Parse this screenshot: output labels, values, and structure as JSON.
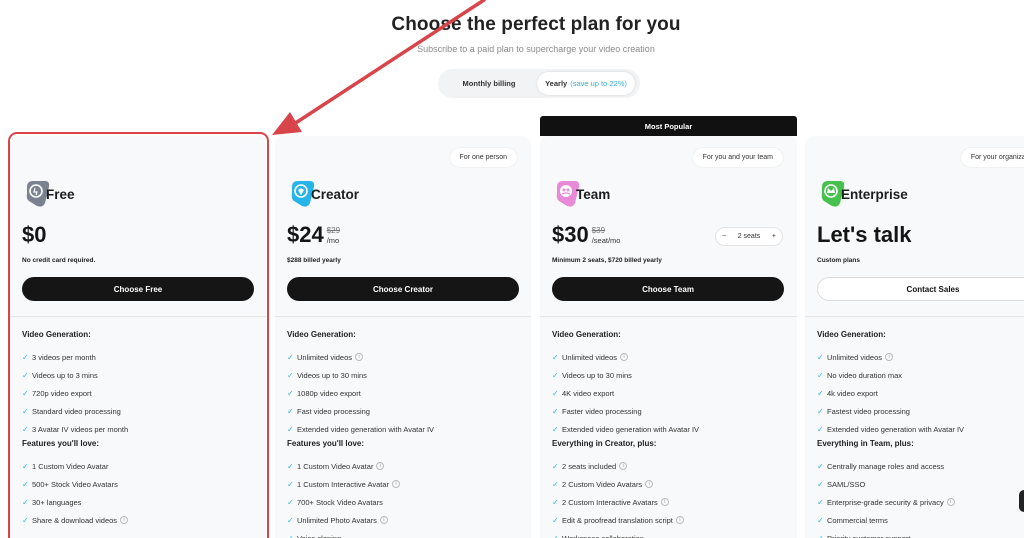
{
  "header": {
    "title": "Choose the perfect plan for you",
    "subtitle": "Subscribe to a paid plan to supercharge your video creation"
  },
  "billing_toggle": {
    "monthly_label": "Monthly billing",
    "yearly_label": "Yearly",
    "yearly_save": "(save up to 22%)",
    "selected": "Yearly"
  },
  "popular_label": "Most Popular",
  "colors": {
    "accent_check": "#2fb6dd",
    "highlight_outline": "#d9444a",
    "free_icon": "#7a8290",
    "creator_icon": "#28b4e8",
    "team_icon": "#e98ad8",
    "enterprise_icon": "#46c14d"
  },
  "plans": [
    {
      "name": "Free",
      "icon": "free-plan-icon",
      "audience": "",
      "price": "$0",
      "price_old": "",
      "price_unit": "",
      "note": "No credit card required.",
      "cta": "Choose Free",
      "sections": [
        {
          "title": "Video Generation:",
          "items": [
            {
              "text": "3 videos per month",
              "info": false
            },
            {
              "text": "Videos up to 3 mins",
              "info": false
            },
            {
              "text": "720p video export",
              "info": false
            },
            {
              "text": "Standard video processing",
              "info": false
            },
            {
              "text": "3 Avatar IV videos per month",
              "info": false
            }
          ]
        },
        {
          "title": "Features you'll love:",
          "items": [
            {
              "text": "1 Custom Video Avatar",
              "info": false
            },
            {
              "text": "500+ Stock Video Avatars",
              "info": false
            },
            {
              "text": "30+ languages",
              "info": false
            },
            {
              "text": "Share & download videos",
              "info": true
            }
          ]
        }
      ]
    },
    {
      "name": "Creator",
      "icon": "creator-plan-icon",
      "audience": "For one person",
      "price": "$24",
      "price_old": "$29",
      "price_unit": "/mo",
      "note": "$288 billed yearly",
      "cta": "Choose Creator",
      "sections": [
        {
          "title": "Video Generation:",
          "items": [
            {
              "text": "Unlimited videos",
              "info": true
            },
            {
              "text": "Videos up to 30 mins",
              "info": false
            },
            {
              "text": "1080p video export",
              "info": false
            },
            {
              "text": "Fast video processing",
              "info": false
            },
            {
              "text": "Extended video generation with Avatar IV",
              "info": false
            }
          ]
        },
        {
          "title": "Features you'll love:",
          "items": [
            {
              "text": "1 Custom Video Avatar",
              "info": true
            },
            {
              "text": "1 Custom Interactive Avatar",
              "info": true
            },
            {
              "text": "700+ Stock Video Avatars",
              "info": false
            },
            {
              "text": "Unlimited Photo Avatars",
              "info": true
            },
            {
              "text": "Voice cloning",
              "info": false
            }
          ]
        }
      ]
    },
    {
      "name": "Team",
      "icon": "team-plan-icon",
      "audience": "For you and your team",
      "price": "$30",
      "price_old": "$39",
      "price_unit": "/seat/mo",
      "note": "Minimum 2 seats, $720 billed yearly",
      "seats": "2 seats",
      "cta": "Choose Team",
      "sections": [
        {
          "title": "Video Generation:",
          "items": [
            {
              "text": "Unlimited videos",
              "info": true
            },
            {
              "text": "Videos up to 30 mins",
              "info": false
            },
            {
              "text": "4K video export",
              "info": false
            },
            {
              "text": "Faster video processing",
              "info": false
            },
            {
              "text": "Extended video generation with Avatar IV",
              "info": false
            }
          ]
        },
        {
          "title": "Everything in Creator, plus:",
          "items": [
            {
              "text": "2 seats included",
              "info": true
            },
            {
              "text": "2 Custom Video Avatars",
              "info": true
            },
            {
              "text": "2 Custom Interactive Avatars",
              "info": true
            },
            {
              "text": "Edit & proofread translation script",
              "info": true
            },
            {
              "text": "Workspace collaboration",
              "info": false
            }
          ]
        }
      ]
    },
    {
      "name": "Enterprise",
      "icon": "enterprise-plan-icon",
      "audience": "For your organization",
      "price": "Let's talk",
      "price_old": "",
      "price_unit": "",
      "note": "Custom plans",
      "cta": "Contact Sales",
      "sections": [
        {
          "title": "Video Generation:",
          "items": [
            {
              "text": "Unlimited videos",
              "info": true
            },
            {
              "text": "No video duration max",
              "info": false
            },
            {
              "text": "4k video export",
              "info": false
            },
            {
              "text": "Fastest video processing",
              "info": false
            },
            {
              "text": "Extended video generation with Avatar IV",
              "info": false
            }
          ]
        },
        {
          "title": "Everything in Team, plus:",
          "items": [
            {
              "text": "Centrally manage roles and access",
              "info": false
            },
            {
              "text": "SAML/SSO",
              "info": false
            },
            {
              "text": "Enterprise-grade security & privacy",
              "info": true
            },
            {
              "text": "Commercial terms",
              "info": false
            },
            {
              "text": "Priority customer support",
              "info": false
            }
          ]
        }
      ]
    }
  ]
}
